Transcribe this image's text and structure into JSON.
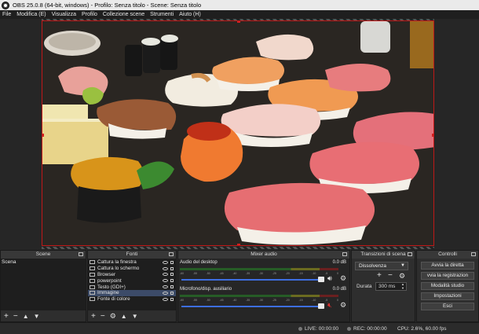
{
  "window": {
    "title": "OBS 25.0.8 (64-bit, windows) - Profilo: Senza titolo - Scene: Senza titolo"
  },
  "menu": [
    "File",
    "Modifica (E)",
    "Visualizza",
    "Profilo",
    "Collezione scene",
    "Strumenti",
    "Aiuto (H)"
  ],
  "docks": {
    "scenes": {
      "title": "Scene",
      "items": [
        "Scena"
      ]
    },
    "sources": {
      "title": "Fonti",
      "items": [
        {
          "label": "Cattura la finestra",
          "icon": "window-icon",
          "selected": false
        },
        {
          "label": "Cattura lo schermo",
          "icon": "monitor-icon",
          "selected": false
        },
        {
          "label": "Browser",
          "icon": "globe-icon",
          "selected": false
        },
        {
          "label": "powerpoint",
          "icon": "window-icon",
          "selected": false
        },
        {
          "label": "Testo (GDI+)",
          "icon": "text-icon",
          "selected": false
        },
        {
          "label": "Immagine",
          "icon": "image-icon",
          "selected": true
        },
        {
          "label": "Fonte di colore",
          "icon": "color-icon",
          "selected": false
        }
      ]
    },
    "mixer": {
      "title": "Mixer audio",
      "scale": [
        "-60",
        "-55",
        "-50",
        "-45",
        "-40",
        "-35",
        "-30",
        "-25",
        "-20",
        "-15",
        "-10",
        "-5",
        "0"
      ],
      "channels": [
        {
          "name": "Audio del desktop",
          "db": "0.0 dB",
          "muted": false
        },
        {
          "name": "Microfono/disp. ausiliario",
          "db": "0.0 dB",
          "muted": true
        }
      ]
    },
    "transitions": {
      "title": "Transizioni di scena",
      "selected": "Dissolvenza",
      "duration_label": "Durata",
      "duration_value": "300 ms"
    },
    "controls": {
      "title": "Controlli",
      "buttons": [
        "Avvia la diretta",
        "vvia la registrazion",
        "Modalità studio",
        "Impostazioni",
        "Esci"
      ]
    }
  },
  "status": {
    "live": "LIVE: 00:00:00",
    "rec": "REC: 00:00:00",
    "cpu": "CPU: 2.6%, 60.00 fps"
  }
}
